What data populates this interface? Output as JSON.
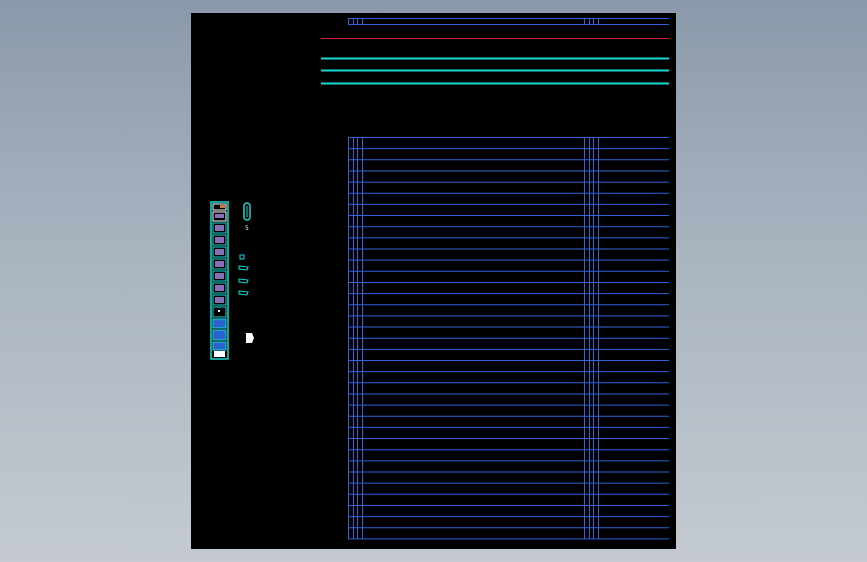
{
  "viewport": {
    "background_top": "#8a99aa",
    "background_bottom": "#c4cad0"
  },
  "sheet": {
    "background": "#000000"
  },
  "colors": {
    "table_line": "#2f63d8",
    "red_line": "#d0211c",
    "cyan_line": "#18d7d0",
    "white": "#ffffff",
    "blue_fill": "#2b62cf",
    "purple_fill": "#8a6fb7",
    "orange_fill": "#c47a3a"
  },
  "icons": {
    "strip": "component-strip-icon",
    "small_shapes": "cad-symbol-icon",
    "white_block": "white-block-icon"
  },
  "table": {
    "top_rows": 2,
    "main_rows": 36
  },
  "labels": {
    "strip_number": "5"
  }
}
